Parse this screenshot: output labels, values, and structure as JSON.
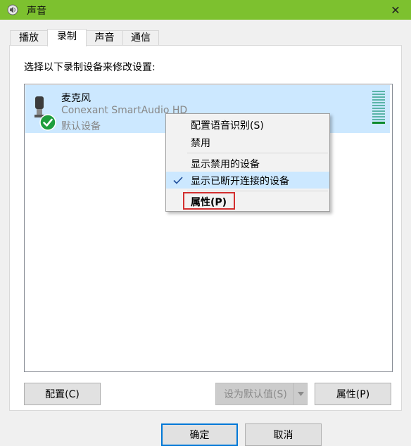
{
  "window": {
    "title": "声音",
    "close_glyph": "✕"
  },
  "tabs": [
    {
      "label": "播放"
    },
    {
      "label": "录制"
    },
    {
      "label": "声音"
    },
    {
      "label": "通信"
    }
  ],
  "recording": {
    "instruction": "选择以下录制设备来修改设置:",
    "device": {
      "name": "麦克风",
      "driver": "Conexant SmartAudio HD",
      "status": "默认设备"
    }
  },
  "context_menu": {
    "items": [
      {
        "label": "配置语音识别(S)"
      },
      {
        "label": "禁用"
      },
      {
        "label": "显示禁用的设备"
      },
      {
        "label": "显示已断开连接的设备"
      },
      {
        "label": "属性(P)"
      }
    ]
  },
  "buttons": {
    "configure": "配置(C)",
    "set_default": "设为默认值(S)",
    "properties": "属性(P)",
    "ok": "确定",
    "cancel": "取消"
  },
  "colors": {
    "titlebar": "#7dc12f",
    "selection": "#cce8ff",
    "accent": "#0078d7",
    "highlight_box": "#d32f2f"
  }
}
